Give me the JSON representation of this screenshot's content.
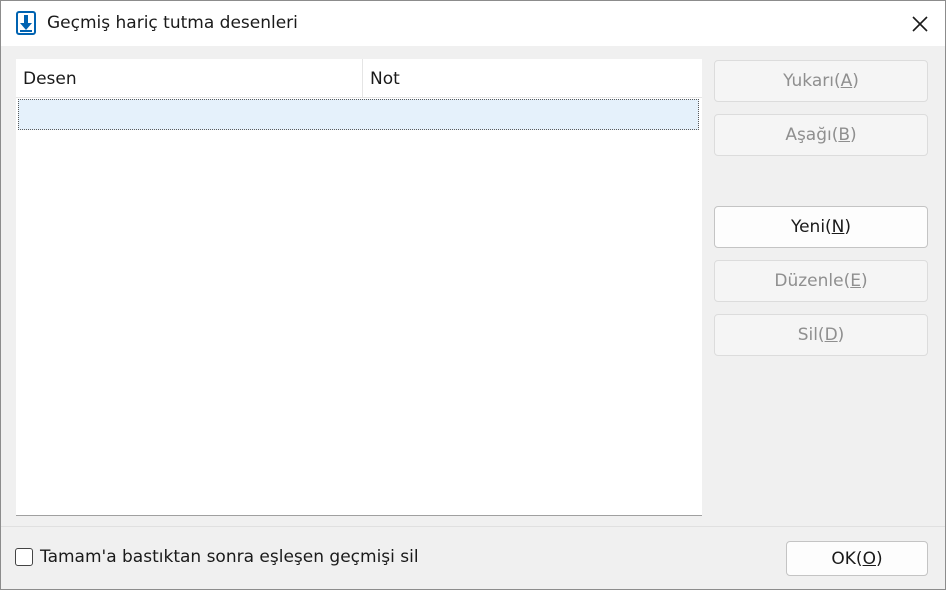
{
  "window": {
    "title": "Geçmiş hariç tutma desenleri",
    "icon": "download-arrow-icon",
    "close_icon": "close-icon"
  },
  "list": {
    "columns": [
      "Desen",
      "Not"
    ],
    "rows": [
      {
        "pattern": "",
        "note": "",
        "selected": true
      }
    ]
  },
  "buttons": {
    "up": {
      "text": "Yukarı(",
      "key": "A",
      "suffix": ")",
      "enabled": false
    },
    "down": {
      "text": "Aşağı(",
      "key": "B",
      "suffix": ")",
      "enabled": false
    },
    "new": {
      "text": "Yeni(",
      "key": "N",
      "suffix": ")",
      "enabled": true
    },
    "edit": {
      "text": "Düzenle(",
      "key": "E",
      "suffix": ")",
      "enabled": false
    },
    "delete": {
      "text": "Sil(",
      "key": "D",
      "suffix": ")",
      "enabled": false
    },
    "ok": {
      "text": "OK(",
      "key": "O",
      "suffix": ")",
      "enabled": true
    }
  },
  "footer": {
    "checkbox_label": "Tamam'a bastıktan sonra eşleşen geçmişi sil",
    "checkbox_checked": false
  },
  "colors": {
    "accent": "#0063b1",
    "selection": "#e5f1fb",
    "disabled_text": "#8f8f8f"
  }
}
